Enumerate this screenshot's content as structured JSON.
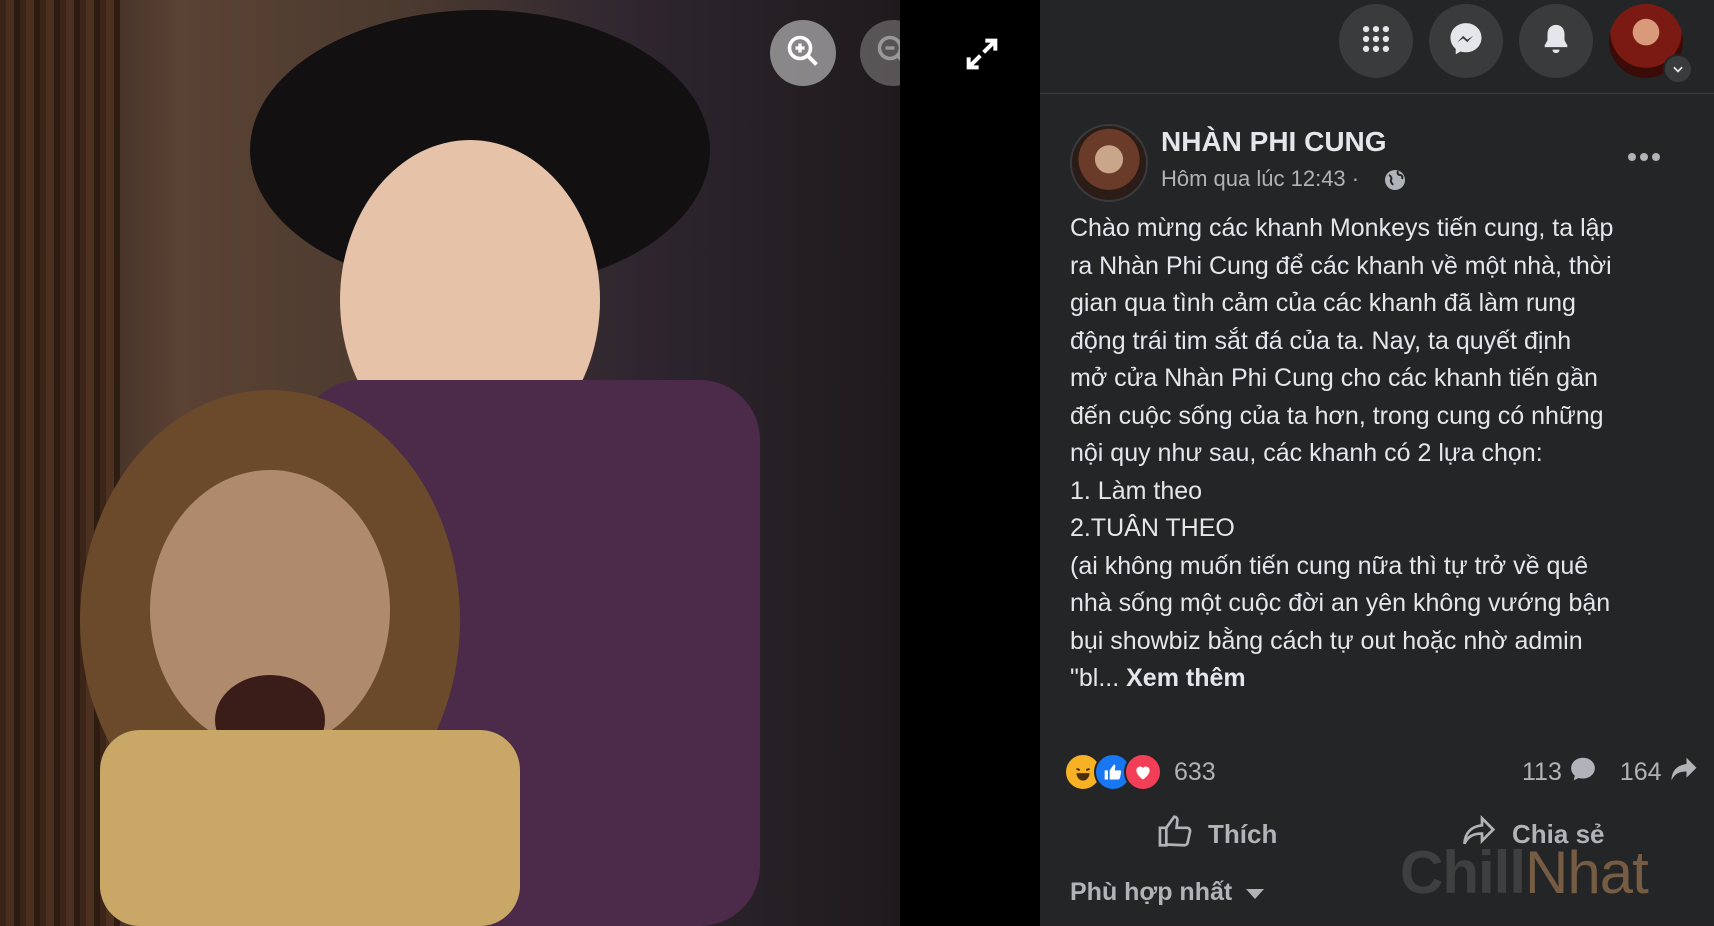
{
  "viewer": {
    "zoom_in_icon": "zoom-in-icon",
    "zoom_out_icon": "zoom-out-icon",
    "fullscreen_icon": "expand-icon"
  },
  "topbar": {
    "menu_icon": "grid-menu-icon",
    "messenger_icon": "messenger-icon",
    "notifications_icon": "bell-icon",
    "account_icon": "avatar"
  },
  "post": {
    "page_name": "NHÀN PHI CUNG",
    "timestamp": "Hôm qua lúc 12:43 ·",
    "privacy_icon": "globe-icon",
    "body": "Chào mừng các khanh Monkeys tiến cung, ta lập\nra Nhàn Phi Cung để các khanh về một nhà, thời\ngian qua tình cảm của các khanh đã làm rung\nđộng trái tim sắt đá của ta. Nay, ta quyết định\nmở cửa Nhàn Phi Cung cho các khanh tiến gần\nđến cuộc sống của ta hơn, trong cung có những\nnội quy như sau, các khanh có 2 lựa chọn:\n1. Làm theo\n2.TUÂN THEO\n(ai không muốn tiến cung nữa thì tự trở về quê\nnhà sống một cuộc đời an yên không vướng bận\nbụi showbiz bằng cách tự out hoặc nhờ admin\n\"bl... ",
    "see_more": "Xem thêm"
  },
  "stats": {
    "reaction_count": "633",
    "comment_count": "113",
    "share_count": "164"
  },
  "actions": {
    "like_label": "Thích",
    "share_label": "Chia sẻ"
  },
  "comments": {
    "sort_label": "Phù hợp nhất"
  },
  "watermark": {
    "part1": "Chill",
    "part2": "Nhat"
  },
  "colors": {
    "panel_bg": "#242526",
    "text_primary": "#e4e6eb",
    "text_secondary": "#b0b3b8",
    "like_blue": "#1877f2",
    "love_red": "#f33e58",
    "haha_yellow": "#f7b125"
  }
}
